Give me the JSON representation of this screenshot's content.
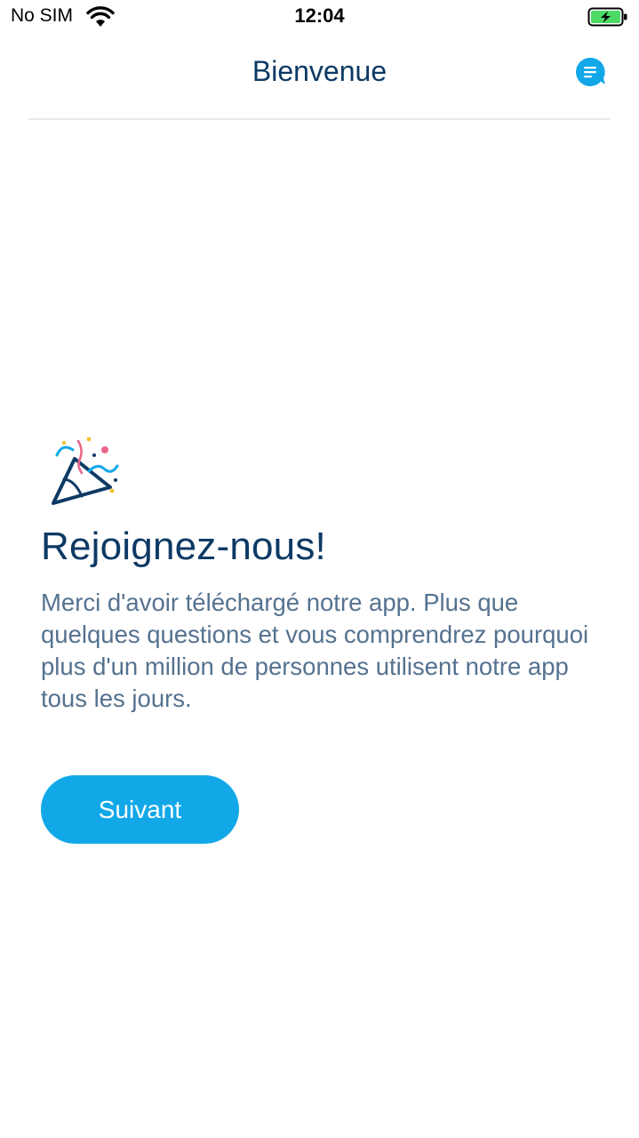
{
  "status_bar": {
    "carrier": "No SIM",
    "time": "12:04",
    "icons": [
      "wifi-icon",
      "battery-charging-icon"
    ]
  },
  "nav": {
    "title": "Bienvenue",
    "chat_icon": "chat-bubble-icon"
  },
  "welcome": {
    "illustration_icon": "party-popper-icon",
    "heading": "Rejoignez-nous!",
    "message": "Merci d'avoir téléchargé notre app. Plus que quelques questions et vous comprendrez pourquoi plus d'un million de personnes utilisent notre app tous les jours.",
    "next_button_label": "Suivant"
  },
  "colors": {
    "primary_dark": "#0d3a64",
    "text_muted": "#55728f",
    "accent_blue": "#12a8e8",
    "battery_green": "#4cd964",
    "confetti_pink": "#e8678a",
    "confetti_yellow": "#f2c230"
  }
}
